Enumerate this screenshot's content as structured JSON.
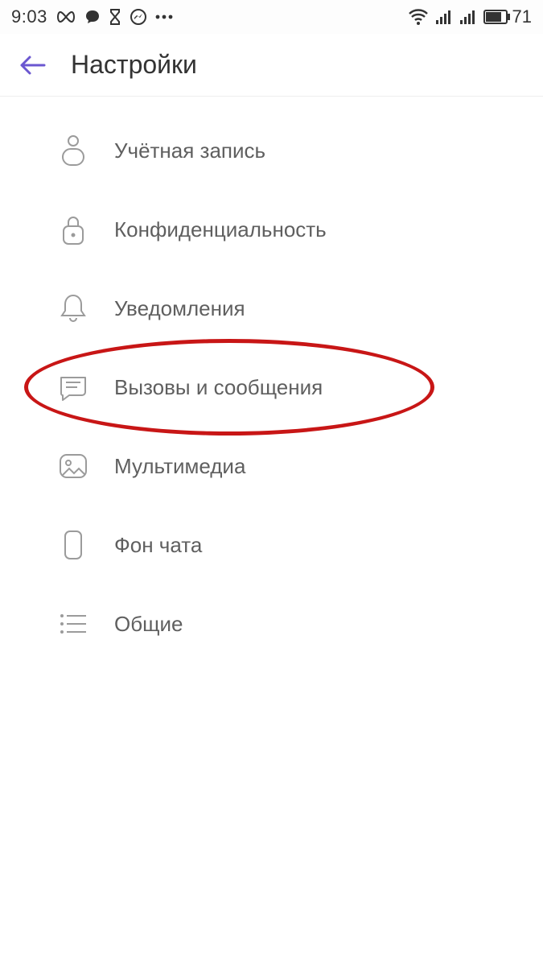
{
  "status": {
    "time": "9:03",
    "icons_left": [
      "infinity",
      "chat",
      "hourglass",
      "messenger",
      "more"
    ],
    "icons_right": [
      "wifi",
      "signal1",
      "signal2",
      "battery"
    ],
    "battery_pct": "71"
  },
  "header": {
    "title": "Настройки"
  },
  "settings": {
    "items": [
      {
        "icon": "user",
        "label": "Учётная запись"
      },
      {
        "icon": "lock",
        "label": "Конфиденциальность"
      },
      {
        "icon": "bell",
        "label": "Уведомления"
      },
      {
        "icon": "chat",
        "label": "Вызовы и сообщения"
      },
      {
        "icon": "media",
        "label": "Мультимедиа"
      },
      {
        "icon": "phone",
        "label": "Фон чата"
      },
      {
        "icon": "list",
        "label": "Общие"
      }
    ],
    "highlighted_index": 3
  }
}
